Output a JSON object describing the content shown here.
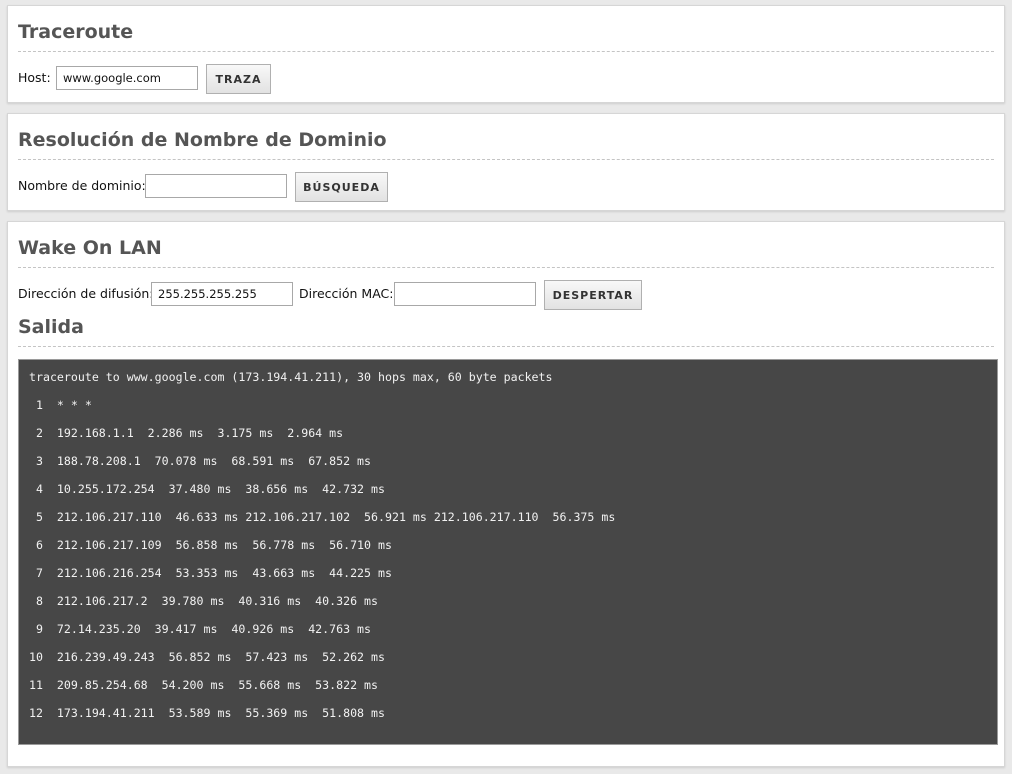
{
  "traceroute": {
    "title": "Traceroute",
    "host_label": "Host:",
    "host_value": "www.google.com",
    "button_label": "TRAZA"
  },
  "dns": {
    "title": "Resolución de Nombre de Dominio",
    "domain_label": "Nombre de dominio:",
    "domain_value": "",
    "button_label": "BÚSQUEDA"
  },
  "wol": {
    "title": "Wake On LAN",
    "broadcast_label": "Dirección de difusión:",
    "broadcast_value": "255.255.255.255",
    "mac_label": "Dirección MAC:",
    "mac_value": "",
    "button_label": "DESPERTAR"
  },
  "output": {
    "title": "Salida",
    "lines": [
      "traceroute to www.google.com (173.194.41.211), 30 hops max, 60 byte packets",
      " 1  * * *",
      " 2  192.168.1.1  2.286 ms  3.175 ms  2.964 ms",
      " 3  188.78.208.1  70.078 ms  68.591 ms  67.852 ms",
      " 4  10.255.172.254  37.480 ms  38.656 ms  42.732 ms",
      " 5  212.106.217.110  46.633 ms 212.106.217.102  56.921 ms 212.106.217.110  56.375 ms",
      " 6  212.106.217.109  56.858 ms  56.778 ms  56.710 ms",
      " 7  212.106.216.254  53.353 ms  43.663 ms  44.225 ms",
      " 8  212.106.217.2  39.780 ms  40.316 ms  40.326 ms",
      " 9  72.14.235.20  39.417 ms  40.926 ms  42.763 ms",
      "10  216.239.49.243  56.852 ms  57.423 ms  52.262 ms",
      "11  209.85.254.68  54.200 ms  55.668 ms  53.822 ms",
      "12  173.194.41.211  53.589 ms  55.369 ms  51.808 ms"
    ]
  }
}
